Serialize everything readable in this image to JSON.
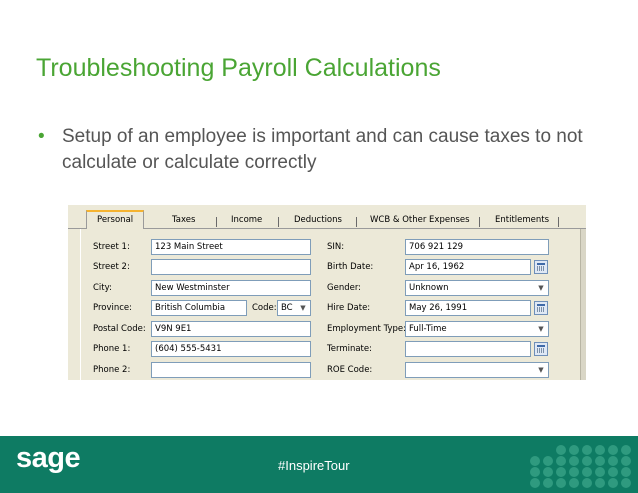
{
  "slide": {
    "title": "Troubleshooting Payroll Calculations",
    "bullet_symbol": "•",
    "bullet_text": "Setup of an employee is important and can cause taxes to not calculate or calculate correctly"
  },
  "dialog": {
    "tabs": [
      "Personal",
      "Taxes",
      "Income",
      "Deductions",
      "WCB & Other Expenses",
      "Entitlements"
    ],
    "active_tab": "Personal",
    "left": {
      "street1_label": "Street 1:",
      "street1_value": "123 Main Street",
      "street2_label": "Street 2:",
      "street2_value": "",
      "city_label": "City:",
      "city_value": "New Westminster",
      "province_label": "Province:",
      "province_value": "British Columbia",
      "code_label": "Code:",
      "code_value": "BC",
      "postal_label": "Postal Code:",
      "postal_value": "V9N 9E1",
      "phone1_label": "Phone 1:",
      "phone1_value": "(604) 555-5431",
      "phone2_label": "Phone 2:",
      "phone2_value": ""
    },
    "right": {
      "sin_label": "SIN:",
      "sin_value": "706 921 129",
      "birth_label": "Birth Date:",
      "birth_value": "Apr 16, 1962",
      "gender_label": "Gender:",
      "gender_value": "Unknown",
      "hire_label": "Hire Date:",
      "hire_value": "May 26, 1991",
      "emptype_label": "Employment Type:",
      "emptype_value": "Full-Time",
      "terminate_label": "Terminate:",
      "terminate_value": "",
      "roe_label": "ROE Code:",
      "roe_value": ""
    }
  },
  "footer": {
    "logo": "sage",
    "hashtag": "#InspireTour",
    "bg_color": "#0e7b63"
  },
  "colors": {
    "title": "#4aa534",
    "body_text": "#555555",
    "accent": "#f5b330"
  }
}
